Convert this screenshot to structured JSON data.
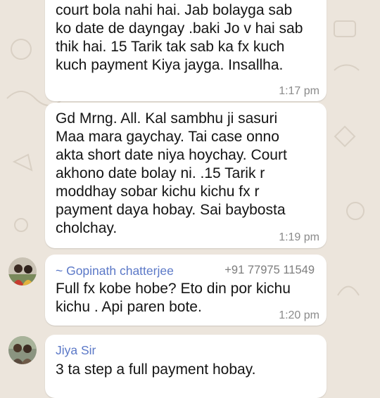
{
  "messages": [
    {
      "text": "court bola nahi hai. Jab bolayga sab\nko date de dayngay .baki Jo v hai sab\nthik hai. 15 Tarik tak sab ka fx kuch\nkuch payment Kiya jayga. Insallha.",
      "time": "1:17 pm"
    },
    {
      "text": "Gd Mrng. All. Kal sambhu ji sasuri\nMaa mara gaychay. Tai case onno\nakta short date niya hoychay. Court\nakhono date bolay ni. .15 Tarik r\nmoddhay sobar kichu kichu fx r\npayment daya hobay. Sai baybosta\ncholchay.",
      "time": "1:19 pm"
    },
    {
      "sender": "~ Gopinath chatterjee",
      "phone": "+91 77975 11549",
      "text": "Full fx kobe hobe? Eto din por kichu\nkichu . Api paren bote.",
      "time": "1:20 pm"
    },
    {
      "sender": "Jiya Sir",
      "text": "3 ta step a full payment hobay."
    }
  ],
  "colors": {
    "background": "#ece5dc",
    "bubble": "#ffffff",
    "sender_name": "#5b78c7",
    "timestamp": "#8a8a8a"
  }
}
